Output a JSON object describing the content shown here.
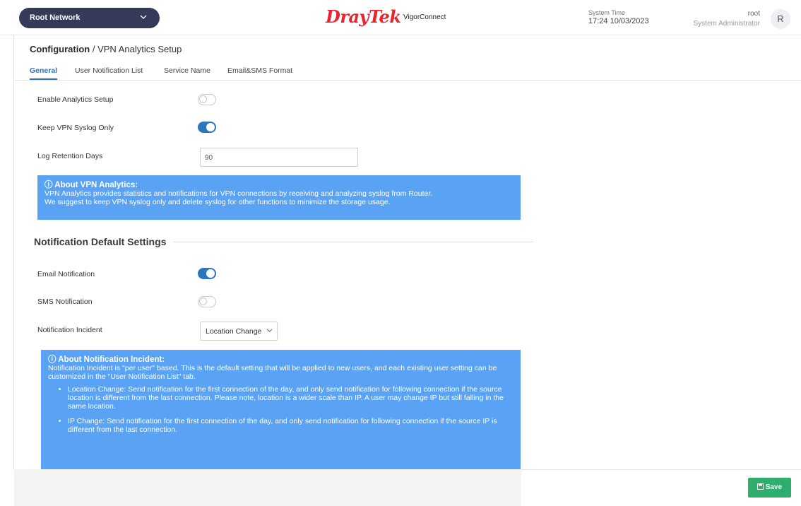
{
  "header": {
    "network_select": "Root Network",
    "brand_logo": "DrayTek",
    "brand_product": "VigorConnect",
    "system_time_label": "System Time",
    "system_time_value": "17:24 10/03/2023",
    "user_name": "root",
    "user_role": "System Administrator",
    "avatar_letter": "R"
  },
  "breadcrumb": {
    "section": "Configuration",
    "separator": "/",
    "page": "VPN Analytics Setup"
  },
  "tabs": [
    {
      "label": "General",
      "active": true
    },
    {
      "label": "User Notification List",
      "active": false
    },
    {
      "label": "Service Name",
      "active": false
    },
    {
      "label": "Email&SMS Format",
      "active": false
    }
  ],
  "settings": {
    "enable_analytics_label": "Enable Analytics Setup",
    "enable_analytics_on": false,
    "keep_syslog_label": "Keep VPN Syslog Only",
    "keep_syslog_on": true,
    "retention_label": "Log Retention Days",
    "retention_value": "90"
  },
  "about_vpn": {
    "title": "ⓘ About VPN Analytics:",
    "line1": "VPN Analytics provides statistics and notifications for VPN connections by receiving and analyzing syslog from Router.",
    "line2": "We suggest to keep VPN syslog only and delete syslog for other functions to minimize the storage usage."
  },
  "notification": {
    "section_title": "Notification Default Settings",
    "email_label": "Email Notification",
    "email_on": true,
    "sms_label": "SMS Notification",
    "sms_on": false,
    "incident_label": "Notification Incident",
    "incident_value": "Location Change"
  },
  "about_incident": {
    "title": "ⓘ About Notification Incident:",
    "line1": "Notification Incident is \"per user\" based. This is the default setting that will be applied to new users, and each existing user setting can be customized in the \"User Notification List\" tab.",
    "bullet1": "Location Change: Send notification for the first connection of the day, and only send notification for following connection if the source location is different from the last connection. Please note, location is a wider scale than IP. A user may change IP but still falling in the same location.",
    "bullet2": "IP Change: Send notification for the first connection of the day, and only send notification for following connection if the source IP is different from the last connection."
  },
  "footer": {
    "save_label": "Save"
  },
  "colors": {
    "accent": "#2c76bd",
    "info_bg": "#5aa3f4",
    "save_bg": "#2dae6c",
    "brand_red": "#e8242f"
  }
}
